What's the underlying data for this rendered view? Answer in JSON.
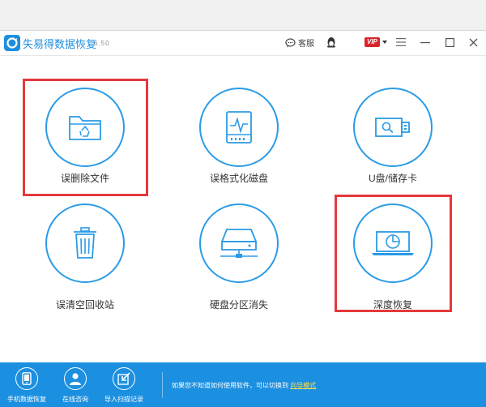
{
  "app": {
    "title": "失易得数据恢复",
    "version": "6.50"
  },
  "titlebar": {
    "service_label": "客服",
    "vip_label": "VIP"
  },
  "tiles": [
    {
      "label": "误删除文件",
      "icon": "folder-recycle-icon"
    },
    {
      "label": "误格式化磁盘",
      "icon": "disk-pulse-icon"
    },
    {
      "label": "U盘/储存卡",
      "icon": "usb-drive-icon"
    },
    {
      "label": "误清空回收站",
      "icon": "trash-bin-icon"
    },
    {
      "label": "硬盘分区消失",
      "icon": "hdd-network-icon"
    },
    {
      "label": "深度恢复",
      "icon": "laptop-deep-scan-icon"
    }
  ],
  "bottombar": {
    "items": [
      {
        "label": "手机数据恢复",
        "icon": "phone-icon"
      },
      {
        "label": "在线咨询",
        "icon": "user-support-icon"
      },
      {
        "label": "导入扫描记录",
        "icon": "import-record-icon"
      }
    ],
    "tip_text": "如果您不知道如何使用软件，可以切换到",
    "tip_link": "向导模式"
  },
  "colors": {
    "accent": "#2a9be6",
    "bottom_bar": "#1b8fe0",
    "highlight": "#e4393c",
    "link": "#ffe04a"
  }
}
